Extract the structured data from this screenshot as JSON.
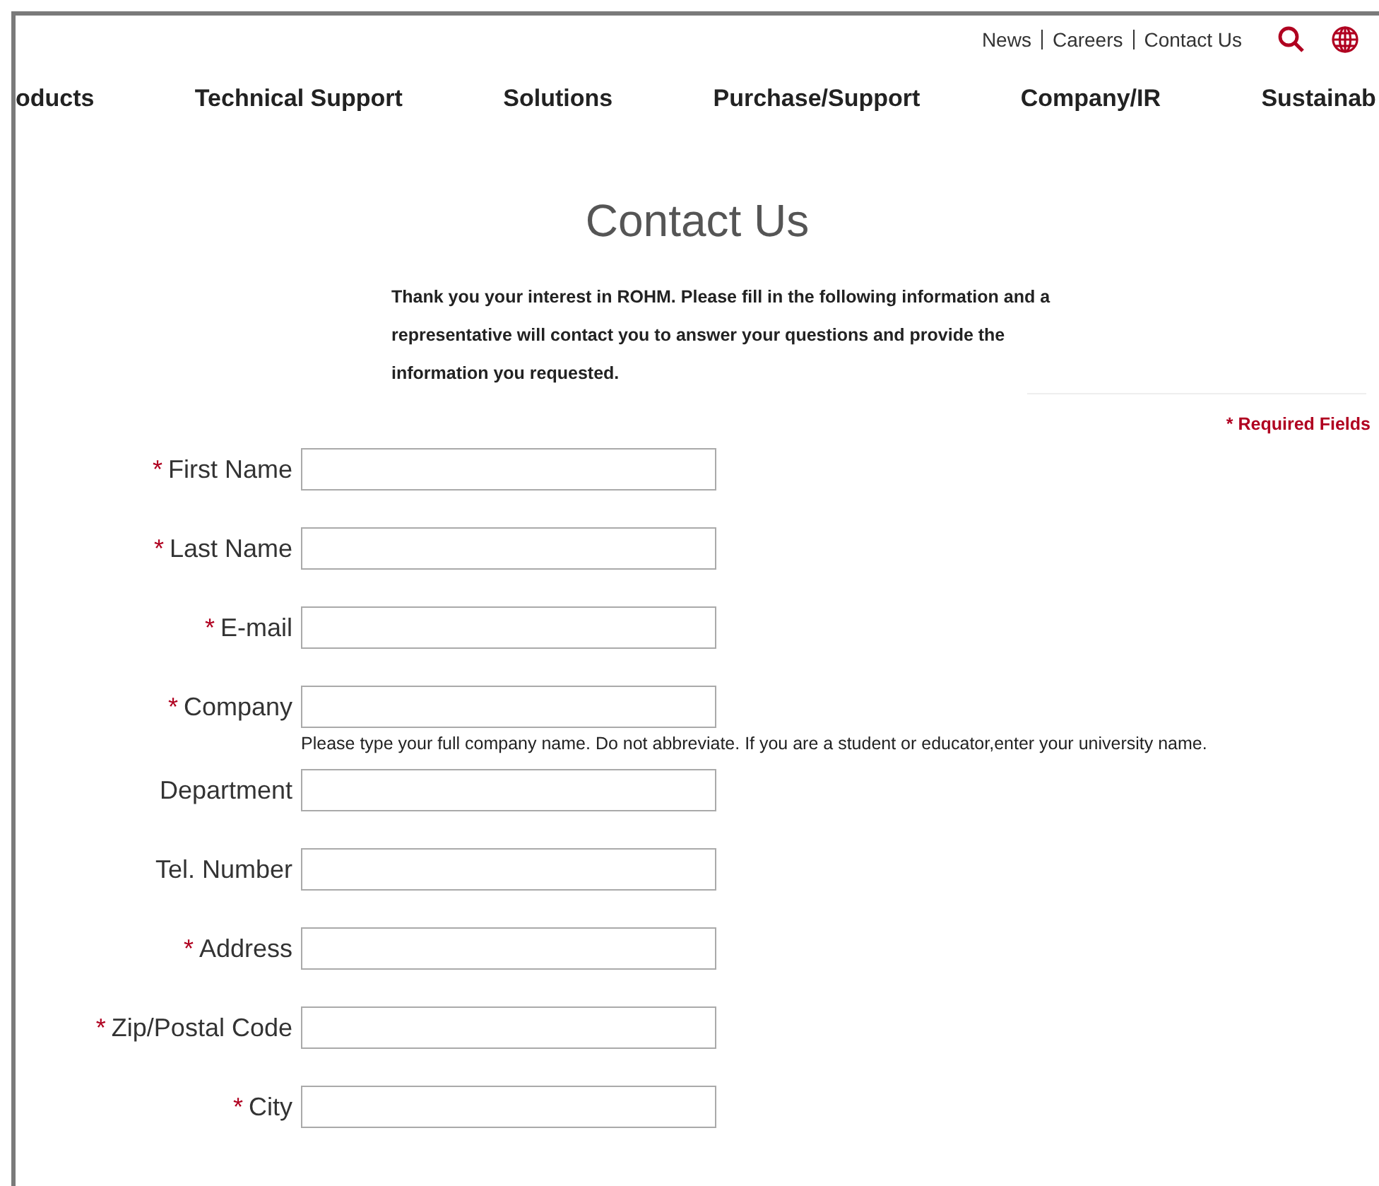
{
  "utility_links": [
    "News",
    "Careers",
    "Contact Us"
  ],
  "nav": [
    "oducts",
    "Technical Support",
    "Solutions",
    "Purchase/Support",
    "Company/IR",
    "Sustainab"
  ],
  "title": "Contact Us",
  "intro": "Thank you your interest in ROHM. Please fill in the following information and a representative will contact you to answer your questions and provide the information you requested.",
  "required_note": "* Required Fields",
  "required_mark": "*",
  "fields": [
    {
      "label": "First Name",
      "required": true
    },
    {
      "label": "Last Name",
      "required": true
    },
    {
      "label": "E-mail",
      "required": true
    },
    {
      "label": "Company",
      "required": true,
      "hint": "Please type your full company name. Do not abbreviate. If you are a student or educator,enter your university name."
    },
    {
      "label": "Department",
      "required": false
    },
    {
      "label": "Tel. Number",
      "required": false
    },
    {
      "label": "Address",
      "required": true
    },
    {
      "label": "Zip/Postal Code",
      "required": true
    },
    {
      "label": "City",
      "required": true
    }
  ]
}
